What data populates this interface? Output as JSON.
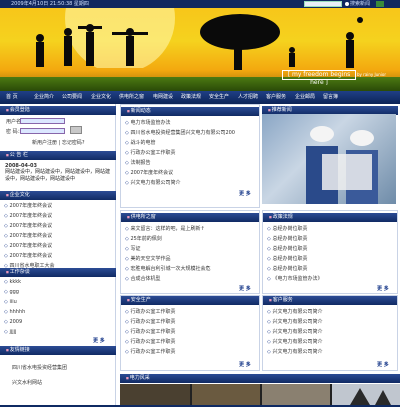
{
  "topbar": {
    "date": "2009年4月10日 21:50:38 星期四",
    "search_option": "搜索新闻"
  },
  "banner": {
    "slogan": "[ my freedom begins here ]",
    "by": "by rainy Junior"
  },
  "nav": [
    "首 页",
    "企业简介",
    "公司要闻",
    "企业文化",
    "供电所之窗",
    "电网建设",
    "政策法规",
    "安全生产",
    "人才招聘",
    "客户服务",
    "企业邮局",
    "留言簿"
  ],
  "login": {
    "title": "会员登陆",
    "user_label": "用户名：",
    "pass_label": "密  码：",
    "links": "新用户注册 | 忘记密码?"
  },
  "announce": {
    "title": "公 告 栏",
    "date": "2008-04-03",
    "body": "网站建设中，网站建设中，网站建设中，网站建设中，网站建设中，网站建设中"
  },
  "culture": {
    "title": "企业文化",
    "items": [
      "2007年度年终会议",
      "2007年度年终会议",
      "2007年度年终会议",
      "2007年度年终会议",
      "2007年度年终会议",
      "2007年度年终会议",
      "四川省水电职工大会"
    ]
  },
  "works": {
    "title": "工作杂谈",
    "items": [
      "kkkk",
      "ggg",
      "iiiu",
      "hhhhh",
      "2009",
      "jjjjj"
    ]
  },
  "friends": {
    "title": "友情链接",
    "items": [
      "四川省水电投资经营集团",
      "兴文水利网站"
    ]
  },
  "news": {
    "title": "新闻动态",
    "items": [
      "电力市场监管办法",
      "四川省水电投资经营集团兴文电力有限公司200",
      "战斗的电管",
      "行政办公室工作职责",
      "法制报告",
      "2007年度年终会议",
      "兴文电力有限公司简介"
    ]
  },
  "photo_panel": {
    "title": "推荐新闻"
  },
  "station": {
    "title": "供电所之窗",
    "items": [
      "来文留言：这样的吧，是上刷新↑",
      "25年前的佩剑",
      "写证",
      "美的天空文学作品",
      "宏胜电解台利引城一次大规模社会危",
      "合成合体机型",
      "合成合体机型"
    ]
  },
  "policy": {
    "title": "政策法规",
    "items": [
      "总经办岗位职责",
      "总经办岗位职责",
      "总经办岗位职责",
      "总经办岗位职责",
      "总经办岗位职责",
      "总经办岗位职责",
      "《电力市场监管办法》"
    ]
  },
  "safety": {
    "title": "安全生产",
    "items": [
      "行政办公室工作职责",
      "行政办公室工作职责",
      "行政办公室工作职责",
      "行政办公室工作职责",
      "行政办公室工作职责",
      "行政办公室工作职责"
    ]
  },
  "service": {
    "title": "客户服务",
    "items": [
      "兴文电力有限公司简介",
      "兴文电力有限公司简介",
      "兴文电力有限公司简介",
      "兴文电力有限公司简介",
      "兴文电力有限公司简介",
      "兴文电力有限公司简介"
    ]
  },
  "photo_strip": {
    "title": "电力风采"
  },
  "more": "更 多"
}
